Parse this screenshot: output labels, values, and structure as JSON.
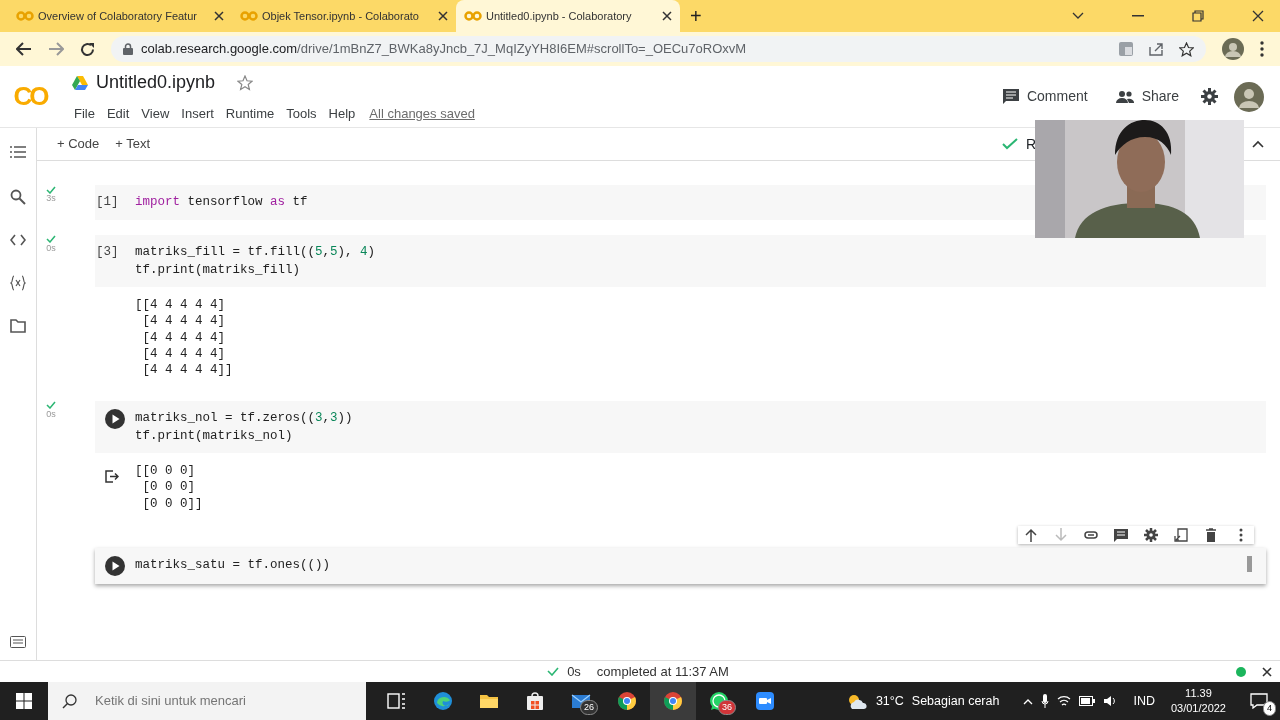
{
  "browser": {
    "tabs": [
      {
        "label": "Overview of Colaboratory Featur",
        "selected": false
      },
      {
        "label": "Objek Tensor.ipynb - Colaborato",
        "selected": false
      },
      {
        "label": "Untitled0.ipynb - Colaboratory",
        "selected": true
      }
    ],
    "new_tab": "+",
    "url_host": "colab.research.google.com",
    "url_path": "/drive/1mBnZ7_BWKa8yJncb_7J_MqIZyYH8I6EM#scrollTo=_OECu7oROxvM"
  },
  "header": {
    "logo": "CO",
    "title": "Untitled0.ipynb",
    "menu": [
      "File",
      "Edit",
      "View",
      "Insert",
      "Runtime",
      "Tools",
      "Help"
    ],
    "save_status": "All changes saved",
    "comment": "Comment",
    "share": "Share"
  },
  "toolbar": {
    "add_code": "+ Code",
    "add_text": "+ Text",
    "runtime_label": "R"
  },
  "cells": [
    {
      "executed": true,
      "time": "3s",
      "prompt": "[1]",
      "focused": false,
      "lines": [
        [
          {
            "kind": "keyword",
            "text": "import"
          },
          {
            "kind": "plain",
            "text": " tensorflow "
          },
          {
            "kind": "keyword",
            "text": "as"
          },
          {
            "kind": "plain",
            "text": " tf"
          }
        ]
      ],
      "output_icon": false
    },
    {
      "executed": true,
      "time": "0s",
      "prompt": "[3]",
      "focused": false,
      "lines": [
        [
          {
            "kind": "plain",
            "text": "matriks_fill = tf.fill(("
          },
          {
            "kind": "number",
            "text": "5"
          },
          {
            "kind": "plain",
            "text": ","
          },
          {
            "kind": "number",
            "text": "5"
          },
          {
            "kind": "plain",
            "text": "), "
          },
          {
            "kind": "number",
            "text": "4"
          },
          {
            "kind": "plain",
            "text": ")"
          }
        ],
        [
          {
            "kind": "plain",
            "text": "tf.print(matriks_fill)"
          }
        ]
      ],
      "output_icon": false,
      "output": [
        "[[4 4 4 4 4]",
        " [4 4 4 4 4]",
        " [4 4 4 4 4]",
        " [4 4 4 4 4]",
        " [4 4 4 4 4]]"
      ]
    },
    {
      "executed": true,
      "time": "0s",
      "focused": false,
      "lines": [
        [
          {
            "kind": "plain",
            "text": "matriks_nol = tf.zeros(("
          },
          {
            "kind": "number",
            "text": "3"
          },
          {
            "kind": "plain",
            "text": ","
          },
          {
            "kind": "number",
            "text": "3"
          },
          {
            "kind": "plain",
            "text": "))"
          }
        ],
        [
          {
            "kind": "plain",
            "text": "tf.print(matriks_nol)"
          }
        ]
      ],
      "output_icon": true,
      "output": [
        "[[0 0 0]",
        " [0 0 0]",
        " [0 0 0]]"
      ]
    },
    {
      "executed": false,
      "focused": true,
      "lines": [
        [
          {
            "kind": "plain",
            "text": "matriks_satu = tf.ones(())"
          }
        ]
      ],
      "output_icon": false
    }
  ],
  "status_bar": {
    "duration": "0s",
    "message": "completed at 11:37 AM"
  },
  "taskbar": {
    "search_placeholder": "Ketik di sini untuk mencari",
    "apps": [
      {
        "kind": "taskview"
      },
      {
        "kind": "edge"
      },
      {
        "kind": "folder"
      },
      {
        "kind": "store"
      },
      {
        "kind": "mail",
        "badge": "26"
      },
      {
        "kind": "chrome"
      },
      {
        "kind": "chrome-active"
      },
      {
        "kind": "whatsapp",
        "badge": "36"
      },
      {
        "kind": "zoom"
      }
    ],
    "temperature": "31°C",
    "weather": "Sebagian cerah",
    "language": "IND",
    "time": "11.39",
    "date": "03/01/2022",
    "notifications": "4"
  }
}
